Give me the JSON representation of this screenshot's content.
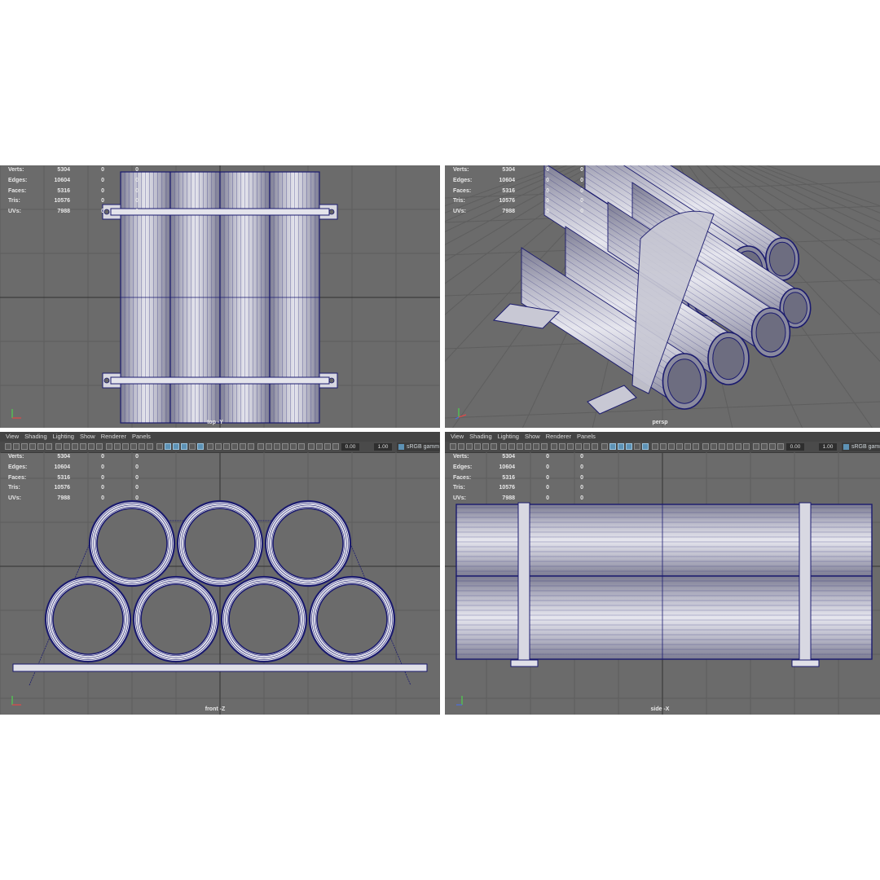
{
  "menu": {
    "items": [
      "View",
      "Shading",
      "Lighting",
      "Show",
      "Renderer",
      "Panels"
    ]
  },
  "toolbar": {
    "exposure": "0.00",
    "gamma": "1.00",
    "color_space": "sRGB gamm"
  },
  "hud": {
    "rows": [
      {
        "label": "Verts:",
        "value": "5304",
        "sel": "0",
        "comp": "0"
      },
      {
        "label": "Edges:",
        "value": "10604",
        "sel": "0",
        "comp": "0"
      },
      {
        "label": "Faces:",
        "value": "5316",
        "sel": "0",
        "comp": "0"
      },
      {
        "label": "Tris:",
        "value": "10576",
        "sel": "0",
        "comp": "0"
      },
      {
        "label": "UVs:",
        "value": "7988",
        "sel": "0",
        "comp": "0"
      }
    ]
  },
  "viewports": {
    "top": {
      "camera": "top -Y"
    },
    "persp": {
      "camera": "persp"
    },
    "front": {
      "camera": "front -Z"
    },
    "side": {
      "camera": "side -X"
    }
  },
  "colors": {
    "viewport_bg": "#6b6b6b",
    "grid": "#5e5e5e",
    "grid_axis": "#3c3c3c",
    "wire": "#1a1a6e",
    "pipe_light": "#e6e6ee",
    "pipe_dark": "#7c7c92",
    "toolbar_active": "#5d92b5"
  }
}
